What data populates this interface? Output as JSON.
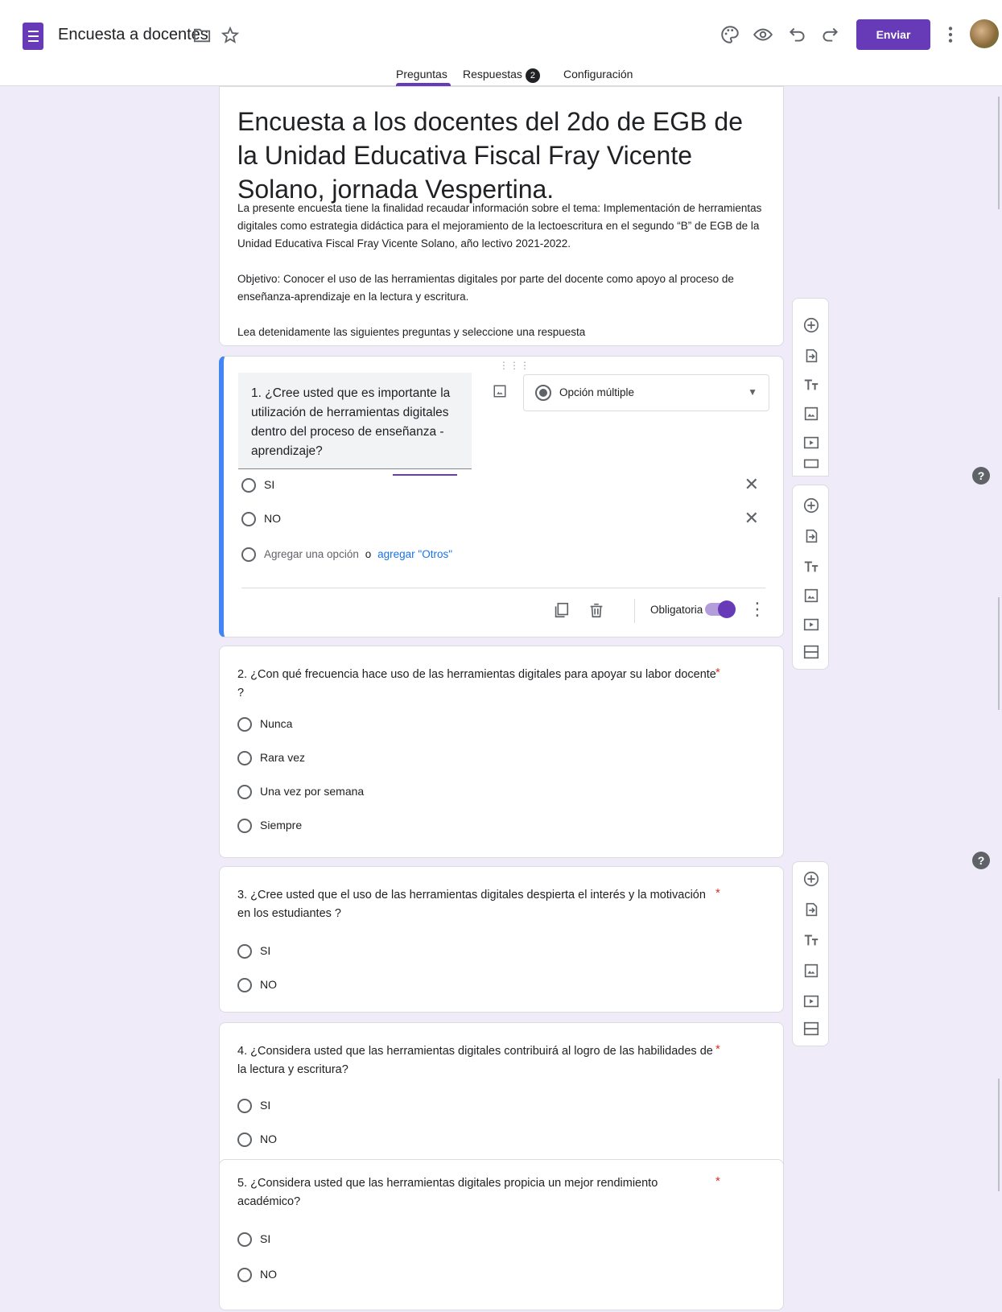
{
  "header": {
    "doc_title": "Encuesta a docentes",
    "send_label": "Enviar",
    "accent_color": "#673ab7"
  },
  "tabs": [
    {
      "label": "Preguntas",
      "active": true
    },
    {
      "label": "Respuestas",
      "badge": "2"
    },
    {
      "label": "Configuración"
    }
  ],
  "form": {
    "title": "Encuesta a los docentes del 2do de EGB de la Unidad Educativa Fiscal Fray Vicente Solano, jornada Vespertina.",
    "description": [
      "La presente encuesta tiene la finalidad recaudar información sobre el tema: Implementación de herramientas digitales como estrategia didáctica para el mejoramiento de la lectoescritura en el segundo “B” de EGB de la Unidad Educativa Fiscal Fray Vicente Solano, año lectivo 2021-2022.",
      "Objetivo:  Conocer el uso de las herramientas digitales por parte del docente como apoyo al proceso de enseñanza-aprendizaje en la lectura y escritura.",
      "Lea detenidamente las siguientes preguntas y seleccione una respuesta"
    ]
  },
  "editing_question": {
    "text": "1. ¿Cree usted que es importante la utilización de herramientas digitales dentro del proceso de enseñanza -aprendizaje?",
    "type_label": "Opción múltiple",
    "options": [
      "SI",
      "NO"
    ],
    "add_option": "Agregar una opción",
    "or_label": "o",
    "add_other": "agregar \"Otros\"",
    "required_label": "Obligatoria",
    "required": true
  },
  "questions": [
    {
      "text": "2. ¿Con qué frecuencia hace uso de las herramientas digitales para apoyar su labor docente ?",
      "required_mark": "*",
      "options": [
        "Nunca",
        "Rara vez",
        "Una vez por semana",
        "Siempre"
      ]
    },
    {
      "text": "3. ¿Cree usted que el uso de las herramientas digitales despierta el interés y la motivación en los estudiantes ?",
      "required_mark": "*",
      "options": [
        "SI",
        "NO"
      ]
    },
    {
      "text": "4. ¿Considera usted que las herramientas digitales contribuirá al logro de las habilidades de la lectura y escritura?",
      "required_mark": "*",
      "options": [
        "SI",
        "NO"
      ]
    },
    {
      "text": "5. ¿Considera usted que las herramientas digitales propicia un mejor rendimiento académico?",
      "required_mark": "*",
      "options": [
        "SI",
        "NO"
      ]
    }
  ],
  "icons": {
    "palette": "palette-icon",
    "preview": "eye-icon",
    "undo": "undo-icon",
    "redo": "redo-icon",
    "more": "more-vert-icon",
    "folder": "folder-icon",
    "star": "star-icon",
    "help": "help-icon",
    "help_glyph": "?"
  }
}
